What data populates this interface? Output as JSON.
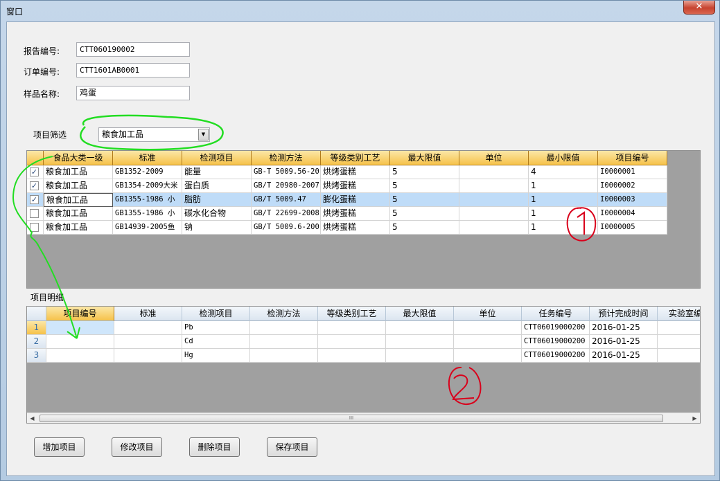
{
  "window": {
    "title": "窗口",
    "close_glyph": "✕"
  },
  "form": {
    "report_no_label": "报告编号:",
    "report_no_value": "CTT060190002",
    "order_no_label": "订单编号:",
    "order_no_value": "CTT1601AB0001",
    "sample_name_label": "样品名称:",
    "sample_name_value": "鸡蛋",
    "filter_label": "项目筛选",
    "filter_value": "粮食加工品"
  },
  "grid1": {
    "columns": [
      "食品大类一级",
      "标准",
      "检测项目",
      "检测方法",
      "等级类别工艺",
      "最大限值",
      "单位",
      "最小限值",
      "项目编号"
    ],
    "rows": [
      {
        "checked": true,
        "c0": "粮食加工品",
        "c1": "GB1352-2009",
        "c2": "能量",
        "c3": "GB-T  5009.56-20",
        "c4": "烘烤蛋糕",
        "c5": "5",
        "c6": "",
        "c7": "4",
        "c8": "I0000001"
      },
      {
        "checked": true,
        "c0": "粮食加工品",
        "c1": "GB1354-2009大米",
        "c2": "蛋白质",
        "c3": "GB/T 20980-2007",
        "c4": "烘烤蛋糕",
        "c5": "5",
        "c6": "",
        "c7": "1",
        "c8": "I0000002"
      },
      {
        "checked": true,
        "c0": "粮食加工品",
        "c1": "GB1355-1986 小",
        "c2": "脂肪",
        "c3": "GB/T 5009.47",
        "c4": "膨化蛋糕",
        "c5": "5",
        "c6": "",
        "c7": "1",
        "c8": "I0000003"
      },
      {
        "checked": false,
        "c0": "粮食加工品",
        "c1": "GB1355-1986 小",
        "c2": "碳水化合物",
        "c3": "GB/T 22699-2008",
        "c4": "烘烤蛋糕",
        "c5": "5",
        "c6": "",
        "c7": "1",
        "c8": "I0000004"
      },
      {
        "checked": false,
        "c0": "粮食加工品",
        "c1": "GB14939-2005鱼",
        "c2": "钠",
        "c3": "GB/T  5009.6-200",
        "c4": "烘烤蛋糕",
        "c5": "5",
        "c6": "",
        "c7": "1",
        "c8": "I0000005"
      }
    ],
    "check_glyph": "✓"
  },
  "detail": {
    "label": "项目明细",
    "columns": [
      "项目编号",
      "标准",
      "检测项目",
      "检测方法",
      "等级类别工艺",
      "最大限值",
      "单位",
      "任务编号",
      "预计完成时间",
      "实验室编"
    ],
    "rows": [
      {
        "num": "1",
        "c0": "",
        "c1": "",
        "c2": "Pb",
        "c3": "",
        "c4": "",
        "c5": "",
        "c6": "",
        "c7": "CTT06019000200",
        "c8": "2016-01-25",
        "c9": ""
      },
      {
        "num": "2",
        "c0": "",
        "c1": "",
        "c2": "Cd",
        "c3": "",
        "c4": "",
        "c5": "",
        "c6": "",
        "c7": "CTT06019000200",
        "c8": "2016-01-25",
        "c9": ""
      },
      {
        "num": "3",
        "c0": "",
        "c1": "",
        "c2": "Hg",
        "c3": "",
        "c4": "",
        "c5": "",
        "c6": "",
        "c7": "CTT06019000200",
        "c8": "2016-01-25",
        "c9": ""
      }
    ],
    "scroll_left_glyph": "◀",
    "scroll_right_glyph": "▶",
    "scroll_grip": "III"
  },
  "buttons": {
    "add": "增加项目",
    "edit": "修改项目",
    "delete": "删除项目",
    "save": "保存项目"
  },
  "annotations": {
    "circle1_color": "#d9001b",
    "circle2_color": "#d9001b",
    "highlight_color": "#22dd22"
  }
}
